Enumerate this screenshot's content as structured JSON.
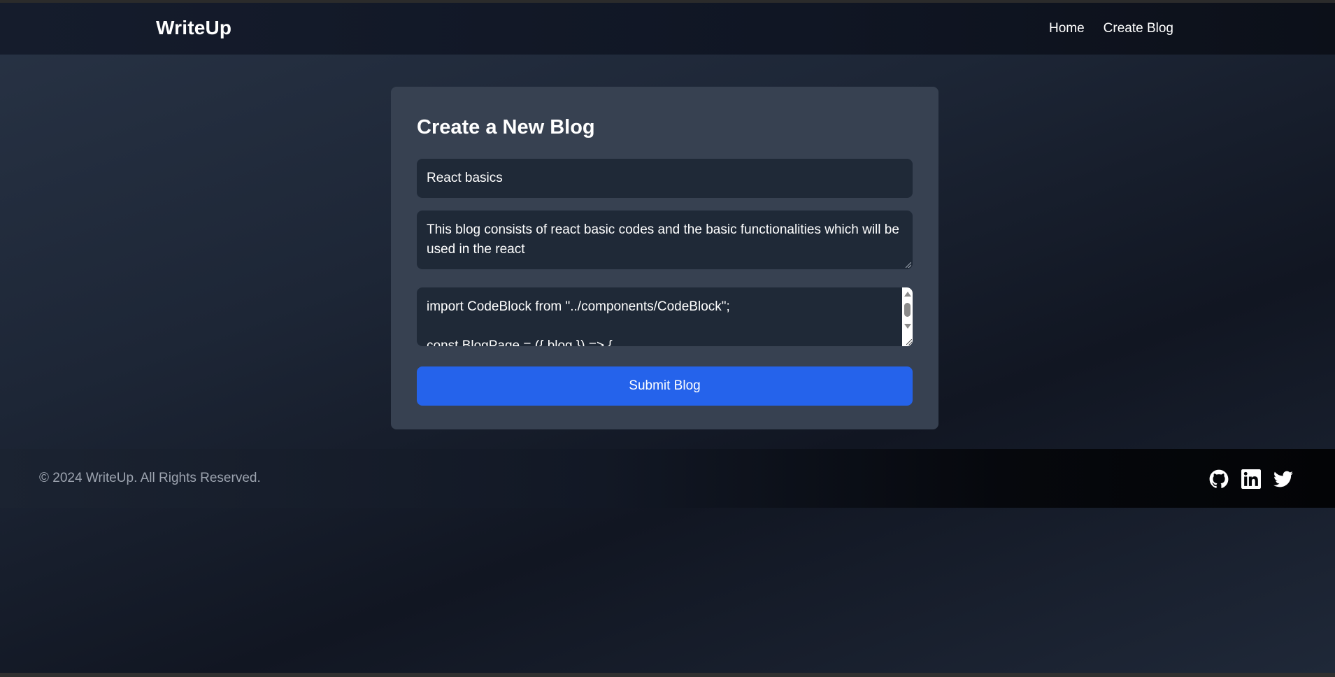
{
  "header": {
    "brand": "WriteUp",
    "nav": [
      {
        "label": "Home"
      },
      {
        "label": "Create Blog"
      }
    ]
  },
  "form": {
    "heading": "Create a New Blog",
    "title_value": "React basics",
    "description_value": "This blog consists of react basic codes and the basic functionalities which will be used in the react",
    "code_lines": [
      "import CodeBlock from \"../components/CodeBlock\";",
      "",
      "const BlogPage = ({ blog }) => {"
    ],
    "submit_label": "Submit Blog"
  },
  "footer": {
    "copyright": "© 2024 WriteUp. All Rights Reserved.",
    "social_icons": [
      "github-icon",
      "linkedin-icon",
      "twitter-icon"
    ]
  },
  "colors": {
    "accent": "#2563eb",
    "card": "#374151",
    "input": "#1f2937"
  }
}
